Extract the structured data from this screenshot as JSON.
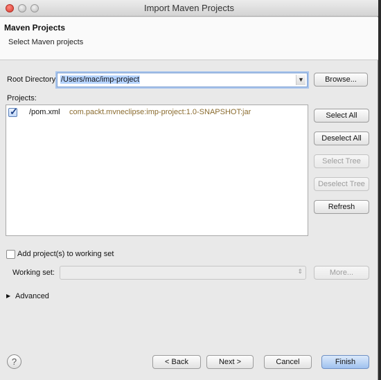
{
  "window": {
    "title": "Import Maven Projects"
  },
  "header": {
    "title": "Maven Projects",
    "description": "Select Maven projects"
  },
  "root_directory": {
    "label": "Root Directory:",
    "value": "/Users/mac/imp-project",
    "browse_label": "Browse..."
  },
  "projects": {
    "label": "Projects:",
    "items": [
      {
        "checked": true,
        "name": "/pom.xml",
        "gav": "com.packt.mvneclipse:imp-project:1.0-SNAPSHOT:jar"
      }
    ],
    "buttons": {
      "select_all": "Select All",
      "deselect_all": "Deselect All",
      "select_tree": "Select Tree",
      "deselect_tree": "Deselect Tree",
      "refresh": "Refresh"
    }
  },
  "working_set": {
    "add_label": "Add project(s) to working set",
    "add_checked": false,
    "label": "Working set:",
    "value": "",
    "more_label": "More..."
  },
  "advanced": {
    "label": "Advanced"
  },
  "footer": {
    "help_label": "?",
    "back_label": "< Back",
    "next_label": "Next >",
    "cancel_label": "Cancel",
    "finish_label": "Finish"
  }
}
